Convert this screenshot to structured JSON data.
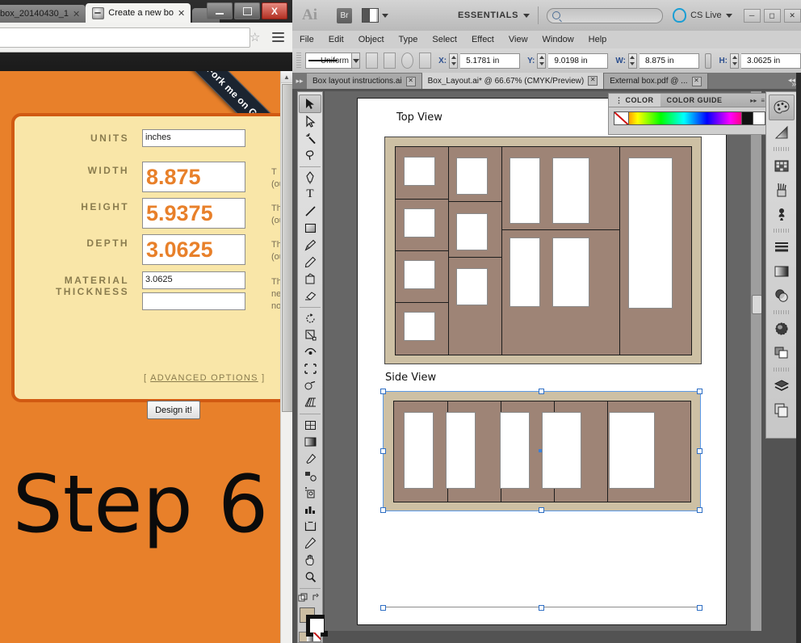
{
  "browser": {
    "tabs": [
      {
        "title": "box_20140430_1",
        "active": false
      },
      {
        "title": "Create a new bo",
        "active": true
      }
    ],
    "close_label": "X",
    "star_icon": "☆",
    "page": {
      "ribbon_text": "Fork me on GitHub",
      "step_text": "Step 6",
      "form": {
        "fields": [
          {
            "label": "UNITS",
            "value": "inches",
            "size": "small",
            "help": ""
          },
          {
            "label": "WIDTH",
            "value": "8.875",
            "size": "big",
            "help": "(out"
          },
          {
            "label": "HEIGHT",
            "value": "5.9375",
            "size": "big",
            "help": "The\n(out"
          },
          {
            "label": "DEPTH",
            "value": "3.0625",
            "size": "big",
            "help": "The\n(out"
          }
        ],
        "material_label_line1": "MATERIAL",
        "material_label_line2": "THICKNESS",
        "material_value": "3.0625",
        "material_value2": "",
        "material_help": "The\nneed\nnotc",
        "advanced_open": "[",
        "advanced_label": "ADVANCED OPTIONS",
        "advanced_close": "]",
        "submit_label": "Design it!"
      }
    }
  },
  "illustrator": {
    "app_logo": "Ai",
    "bridge_label": "Br",
    "workspace": "ESSENTIALS",
    "search_placeholder": "",
    "cslive_label": "CS Live",
    "menus": [
      "File",
      "Edit",
      "Object",
      "Type",
      "Select",
      "Effect",
      "View",
      "Window",
      "Help"
    ],
    "control_bar": {
      "stroke_profile": "Uniform",
      "x_label": "X:",
      "x_value": "5.1781 in",
      "y_label": "Y:",
      "y_value": "9.0198 in",
      "w_label": "W:",
      "w_value": "8.875 in",
      "h_label": "H:",
      "h_value": "3.0625 in"
    },
    "doc_tabs": [
      {
        "title": "Box layout instructions.ai",
        "active": false
      },
      {
        "title": "Box_Layout.ai* @ 66.67% (CMYK/Preview)",
        "active": true
      },
      {
        "title": "External box.pdf @ ...",
        "active": false
      }
    ],
    "doc_tabs_overflow": "»",
    "color_panel": {
      "tab_color": "COLOR",
      "tab_color_guide": "COLOR GUIDE",
      "expand_icon": "▸▸",
      "menu_icon": "≡"
    },
    "artboard": {
      "top_view_label": "Top View",
      "side_view_label": "Side View",
      "box_fill": "#cdc0a4",
      "divider_fill": "#9e8476",
      "slot_fill": "#ffffff",
      "selection_color": "#5c9ae8"
    },
    "tools": [
      "selection-tool",
      "direct-selection-tool",
      "magic-wand-tool",
      "lasso-tool",
      "pen-tool",
      "type-tool",
      "line-tool",
      "rectangle-tool",
      "paintbrush-tool",
      "pencil-tool",
      "blob-brush-tool",
      "eraser-tool",
      "rotate-tool",
      "scale-tool",
      "width-tool",
      "free-transform-tool",
      "shape-builder-tool",
      "perspective-grid-tool",
      "mesh-tool",
      "gradient-tool",
      "eyedropper-tool",
      "blend-tool",
      "symbol-sprayer-tool",
      "column-graph-tool",
      "artboard-tool",
      "slice-tool",
      "hand-tool",
      "zoom-tool"
    ],
    "dock_panels": [
      "color-panel-icon",
      "gradient-panel-icon",
      "swatches-panel-icon",
      "brushes-panel-icon",
      "symbols-panel-icon",
      "stroke-panel-icon",
      "gradient2-panel-icon",
      "transparency-panel-icon",
      "appearance-panel-icon",
      "graphic-styles-panel-icon",
      "layers-panel-icon",
      "artboards-panel-icon"
    ]
  }
}
